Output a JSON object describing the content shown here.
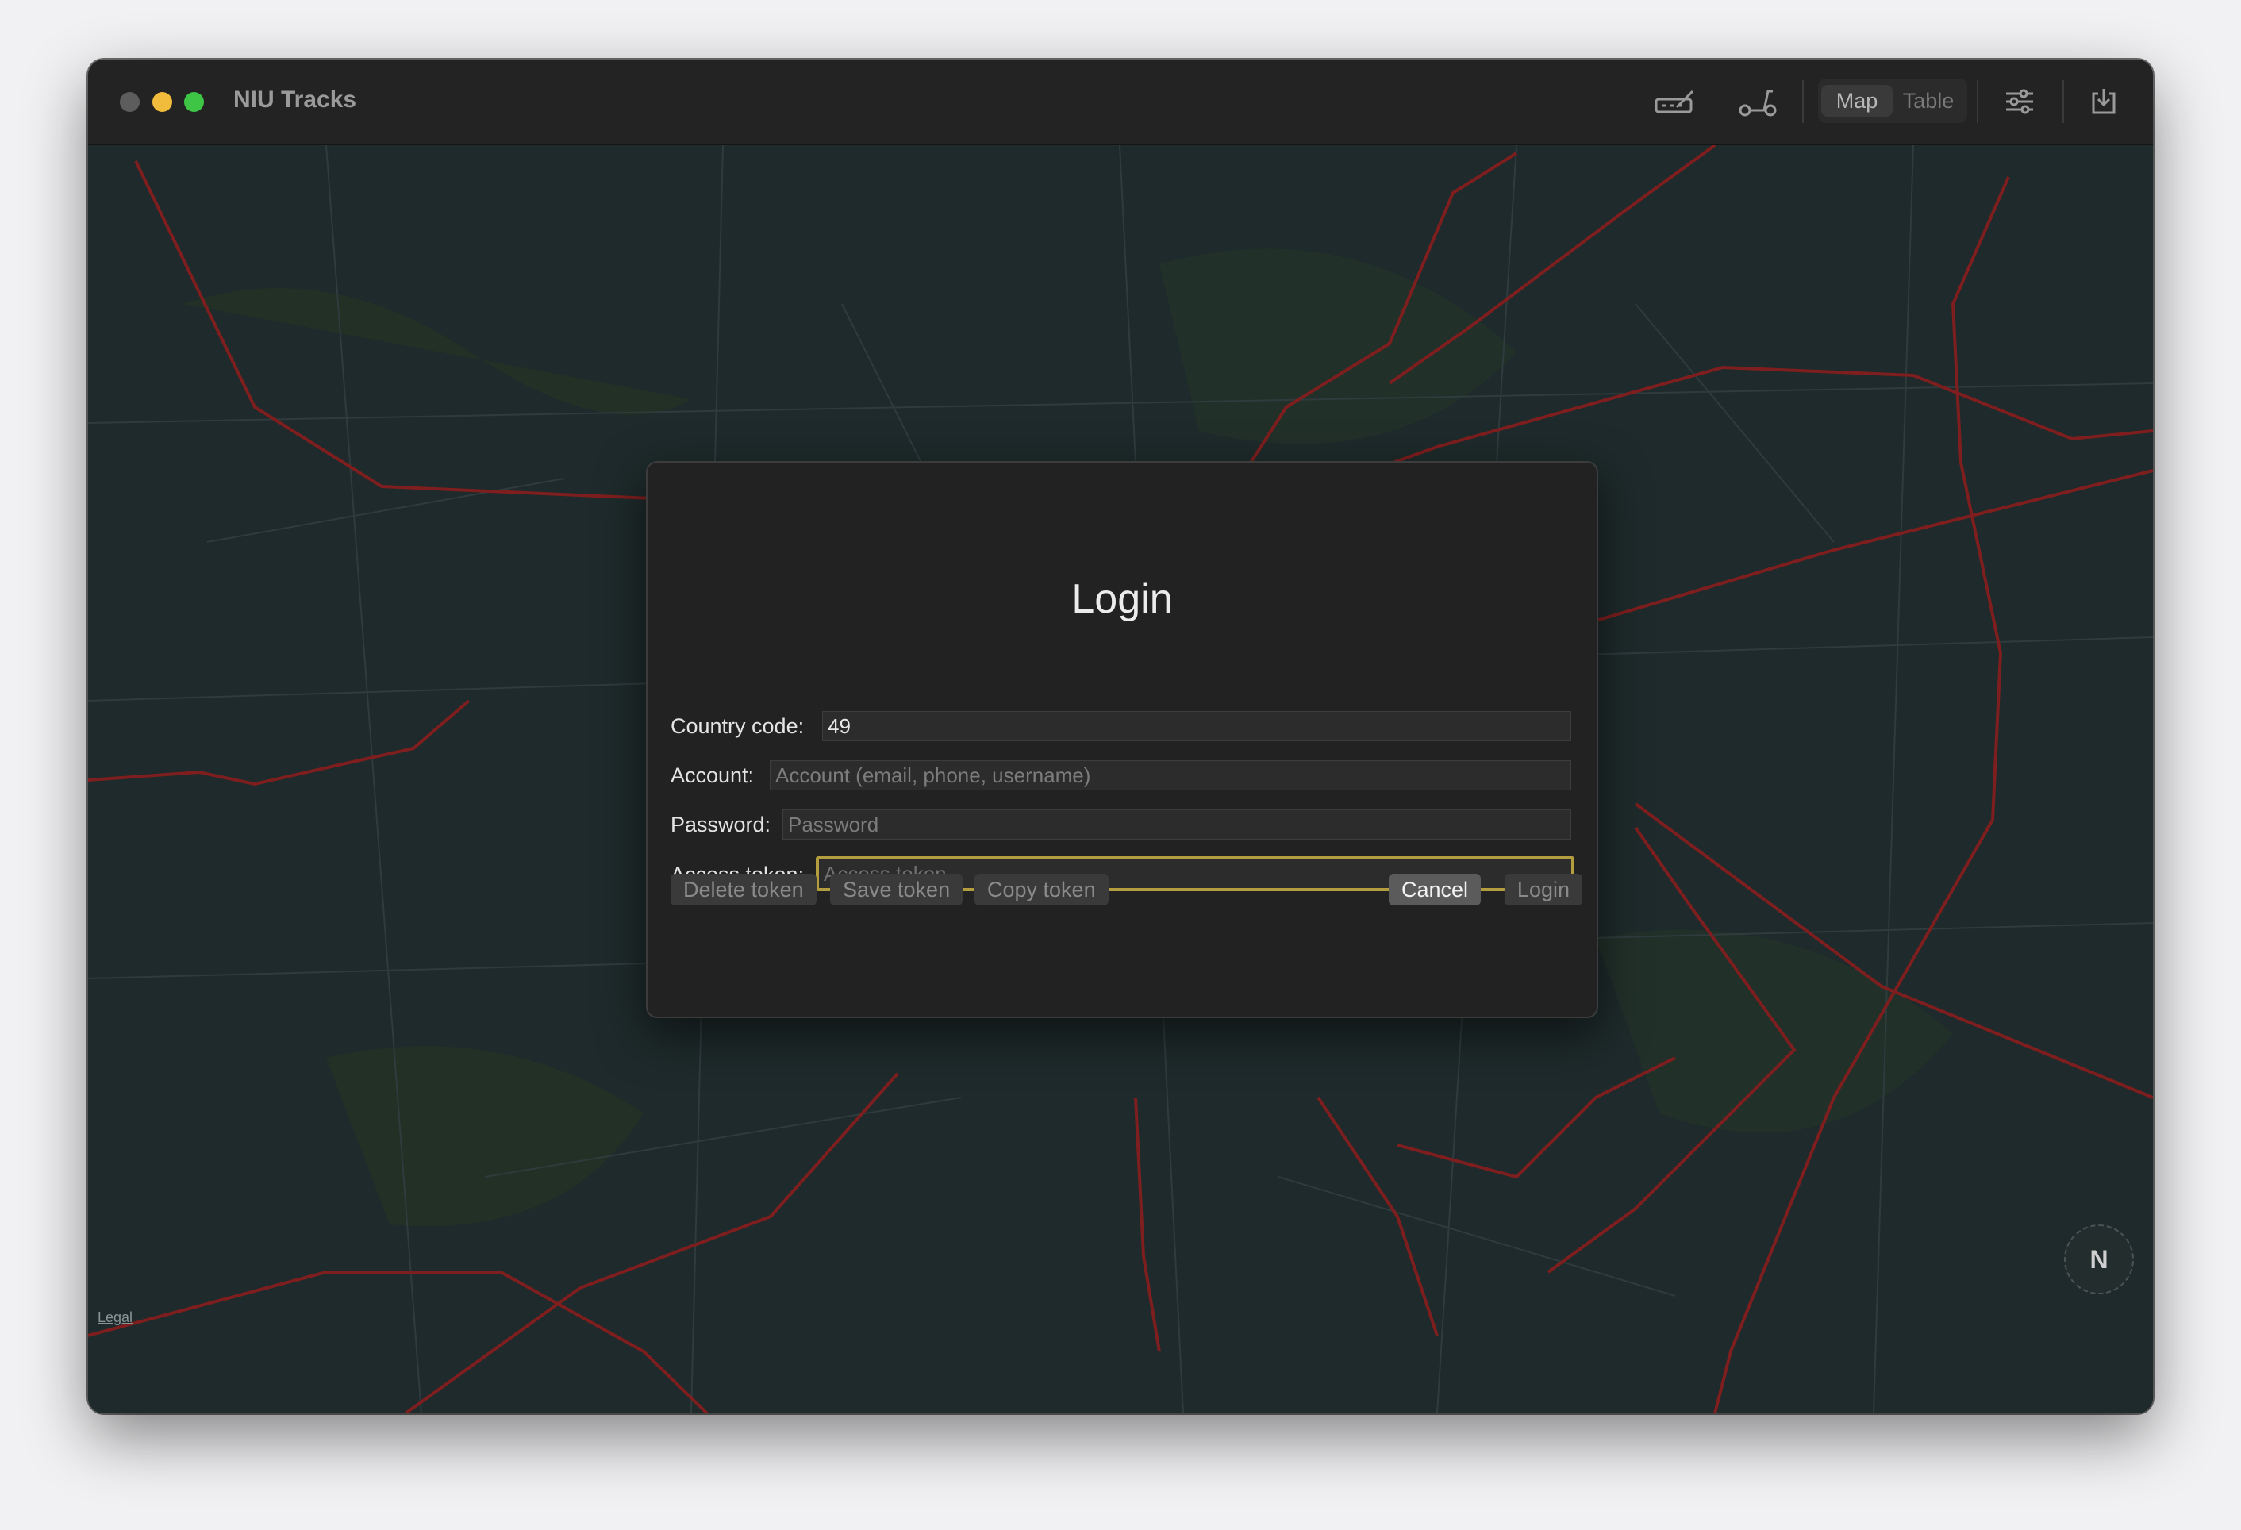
{
  "window": {
    "title": "NIU Tracks",
    "toolbar": {
      "icons": [
        "speedometer-icon",
        "scooter-icon",
        "sliders-icon",
        "download-icon"
      ],
      "view_segments": [
        "Map",
        "Table"
      ],
      "selected_view": "Map"
    }
  },
  "map": {
    "legal_label": "Legal",
    "compass_label": "N"
  },
  "login_dialog": {
    "title": "Login",
    "country_code_label": "Country code:",
    "country_code_value": "49",
    "account_label": "Account:",
    "account_placeholder": "Account (email, phone, username)",
    "password_label": "Password:",
    "password_placeholder": "Password",
    "access_token_label": "Access token:",
    "access_token_placeholder": "Access token",
    "buttons": {
      "delete_token": "Delete token",
      "save_token": "Save token",
      "copy_token": "Copy token",
      "cancel": "Cancel",
      "login": "Login"
    }
  },
  "colors": {
    "accent_focus": "#b39d3e",
    "route_red": "#8c1f1f",
    "map_background": "#1e2a2b"
  }
}
